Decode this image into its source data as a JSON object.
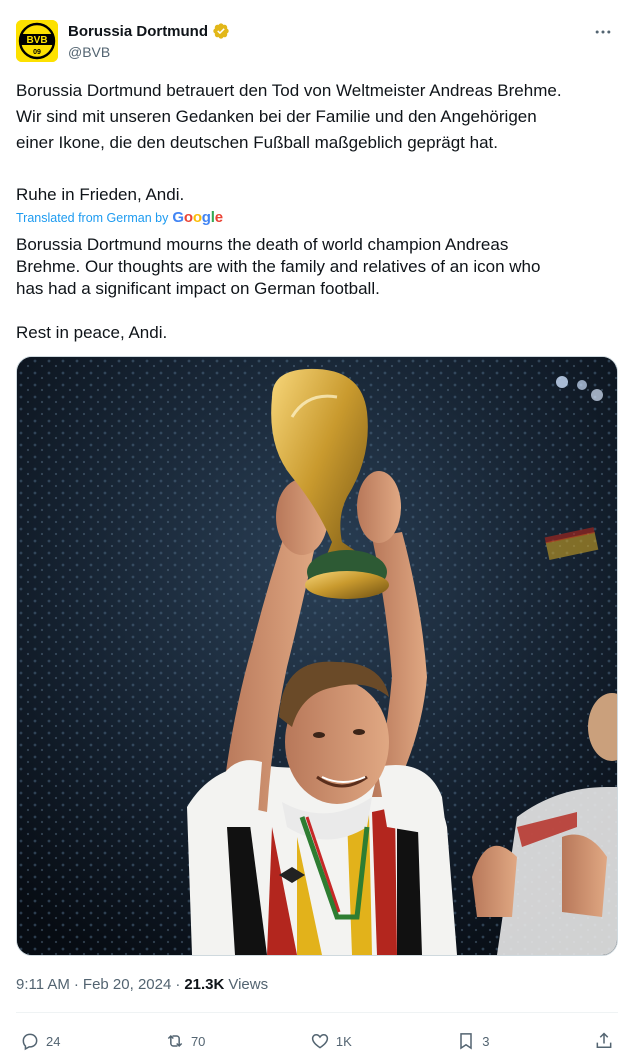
{
  "account": {
    "display_name": "Borussia Dortmund",
    "handle": "@BVB",
    "avatar_letters": "BVB",
    "avatar_year": "09",
    "verified_color": "#e2b719",
    "brand_color": "#fde100"
  },
  "more_icon": "more-horizontal-icon",
  "tweet": {
    "original_p1": "Borussia Dortmund betrauert den Tod von Weltmeister Andreas Brehme.\nWir sind mit unseren Gedanken bei der Familie und den Angehörigen\neiner Ikone, die den deutschen Fußball maßgeblich geprägt hat.",
    "original_p2": "Ruhe in Frieden, Andi.",
    "translated_label": "Translated from German by",
    "translation_p1": "Borussia Dortmund mourns the death of world champion Andreas\nBrehme. Our thoughts are with the family and relatives of an icon who\nhas had a significant impact on German football.",
    "translation_p2": "Rest in peace, Andi."
  },
  "google_logo": [
    "G",
    "o",
    "o",
    "g",
    "l",
    "e"
  ],
  "meta": {
    "time": "9:11 AM",
    "separator": "·",
    "date": "Feb 20, 2024",
    "separator2": "·",
    "views_count": "21.3K",
    "views_label": "Views"
  },
  "actions": {
    "replies": "24",
    "reposts": "70",
    "likes": "1K",
    "bookmarks": "3"
  }
}
